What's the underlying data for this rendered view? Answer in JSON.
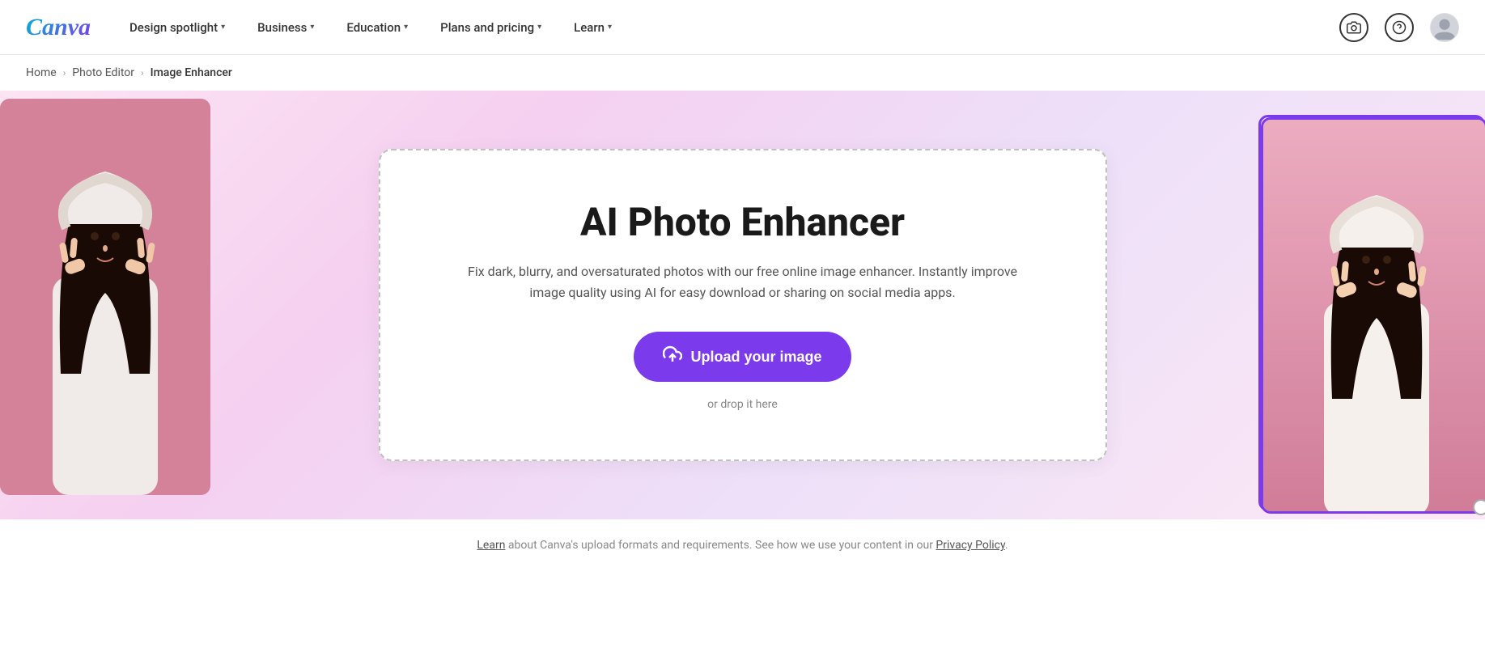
{
  "nav": {
    "logo": "Canva",
    "links": [
      {
        "label": "Design spotlight",
        "has_dropdown": true
      },
      {
        "label": "Business",
        "has_dropdown": true
      },
      {
        "label": "Education",
        "has_dropdown": true
      },
      {
        "label": "Plans and pricing",
        "has_dropdown": true
      },
      {
        "label": "Learn",
        "has_dropdown": true
      }
    ]
  },
  "breadcrumb": {
    "home": "Home",
    "photo_editor": "Photo Editor",
    "current": "Image Enhancer"
  },
  "hero": {
    "title": "AI Photo Enhancer",
    "description": "Fix dark, blurry, and oversaturated photos with our free online image enhancer. Instantly improve image quality using AI for easy download or sharing on social media apps.",
    "upload_btn": "Upload your image",
    "drop_text": "or drop it here"
  },
  "footer": {
    "learn_link": "Learn",
    "text": " about Canva's upload formats and requirements. See how we use your content in our ",
    "privacy_link": "Privacy Policy",
    "period": "."
  },
  "icons": {
    "camera": "📷",
    "help": "?",
    "upload_cloud": "☁"
  },
  "colors": {
    "brand_purple": "#7c3aed",
    "brand_teal": "#00c4cc",
    "hero_bg_start": "#fce4f3",
    "hero_bg_end": "#ede0f8"
  }
}
